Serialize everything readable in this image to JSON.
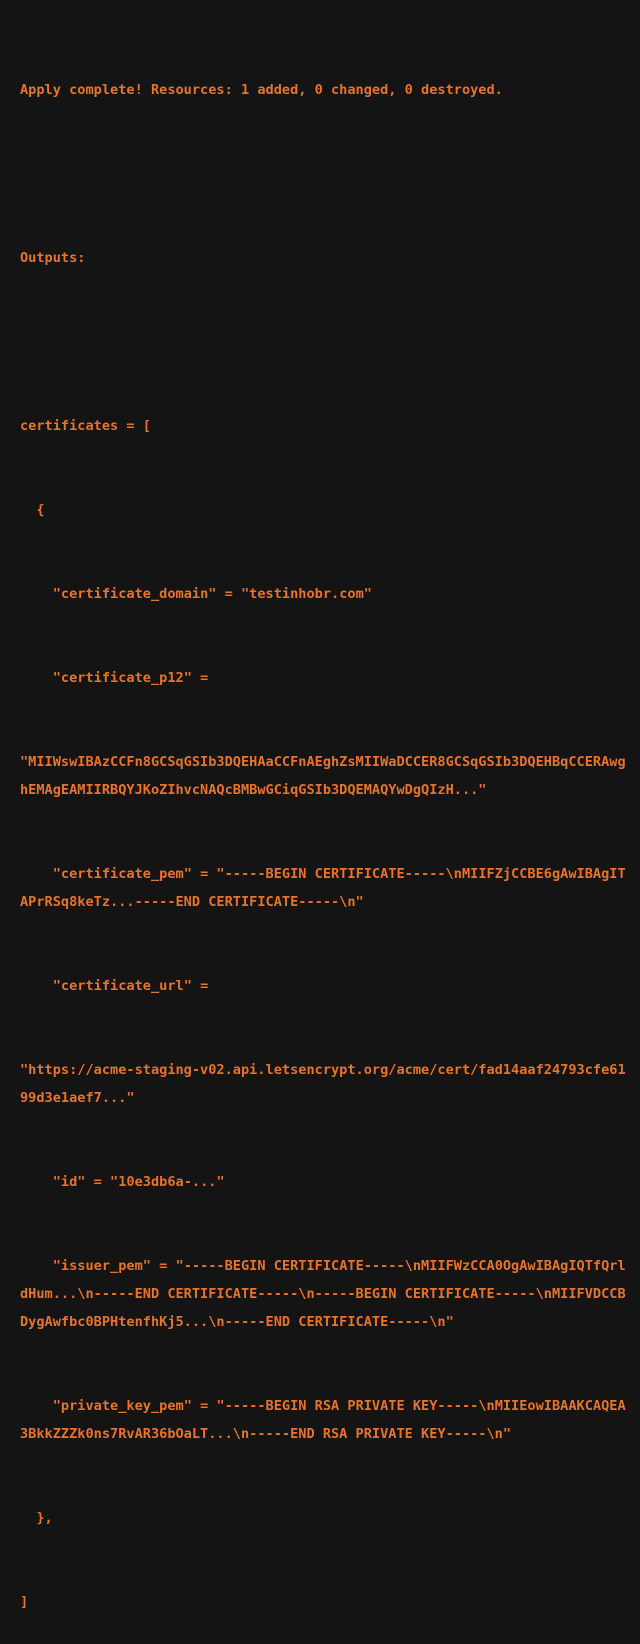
{
  "terminal": {
    "background_color": "#141414",
    "text_color": "#e8732a",
    "lines": {
      "apply_complete": "Apply complete! Resources: 1 added, 0 changed, 0 destroyed.",
      "outputs_header": "Outputs:",
      "certificates_open": "certificates = [",
      "object_open": "  {",
      "certificate_domain": "    \"certificate_domain\" = \"testinhobr.com\"",
      "certificate_p12_key": "    \"certificate_p12\" =",
      "certificate_p12_value": "\"MIIWswIBAzCCFn8GCSqGSIb3DQEHAaCCFnAEghZsMIIWaDCCER8GCSqGSIb3DQEHBqCCERAwghEMAgEAMIIRBQYJKoZIhvcNAQcBMBwGCiqGSIb3DQEMAQYwDgQIzH...\"",
      "certificate_pem": "    \"certificate_pem\" = \"-----BEGIN CERTIFICATE-----\\nMIIFZjCCBE6gAwIBAgITAPrRSq8keTz...-----END CERTIFICATE-----\\n\"",
      "certificate_url_key": "    \"certificate_url\" =",
      "certificate_url_value": "\"https://acme-staging-v02.api.letsencrypt.org/acme/cert/fad14aaf24793cfe6199d3e1aef7...\"",
      "id": "    \"id\" = \"10e3db6a-...\"",
      "issuer_pem": "    \"issuer_pem\" = \"-----BEGIN CERTIFICATE-----\\nMIIFWzCCA0OgAwIBAgIQTfQrldHum...\\n-----END CERTIFICATE-----\\n-----BEGIN CERTIFICATE-----\\nMIIFVDCCBDygAwfbc0BPHtenfhKj5...\\n-----END CERTIFICATE-----\\n\"",
      "private_key_pem": "    \"private_key_pem\" = \"-----BEGIN RSA PRIVATE KEY-----\\nMIIEowIBAAKCAQEA3BkkZZZk0ns7RvAR36bOaLT...\\n-----END RSA PRIVATE KEY-----\\n\"",
      "object_close": "  },",
      "certificates_close": "]"
    }
  }
}
